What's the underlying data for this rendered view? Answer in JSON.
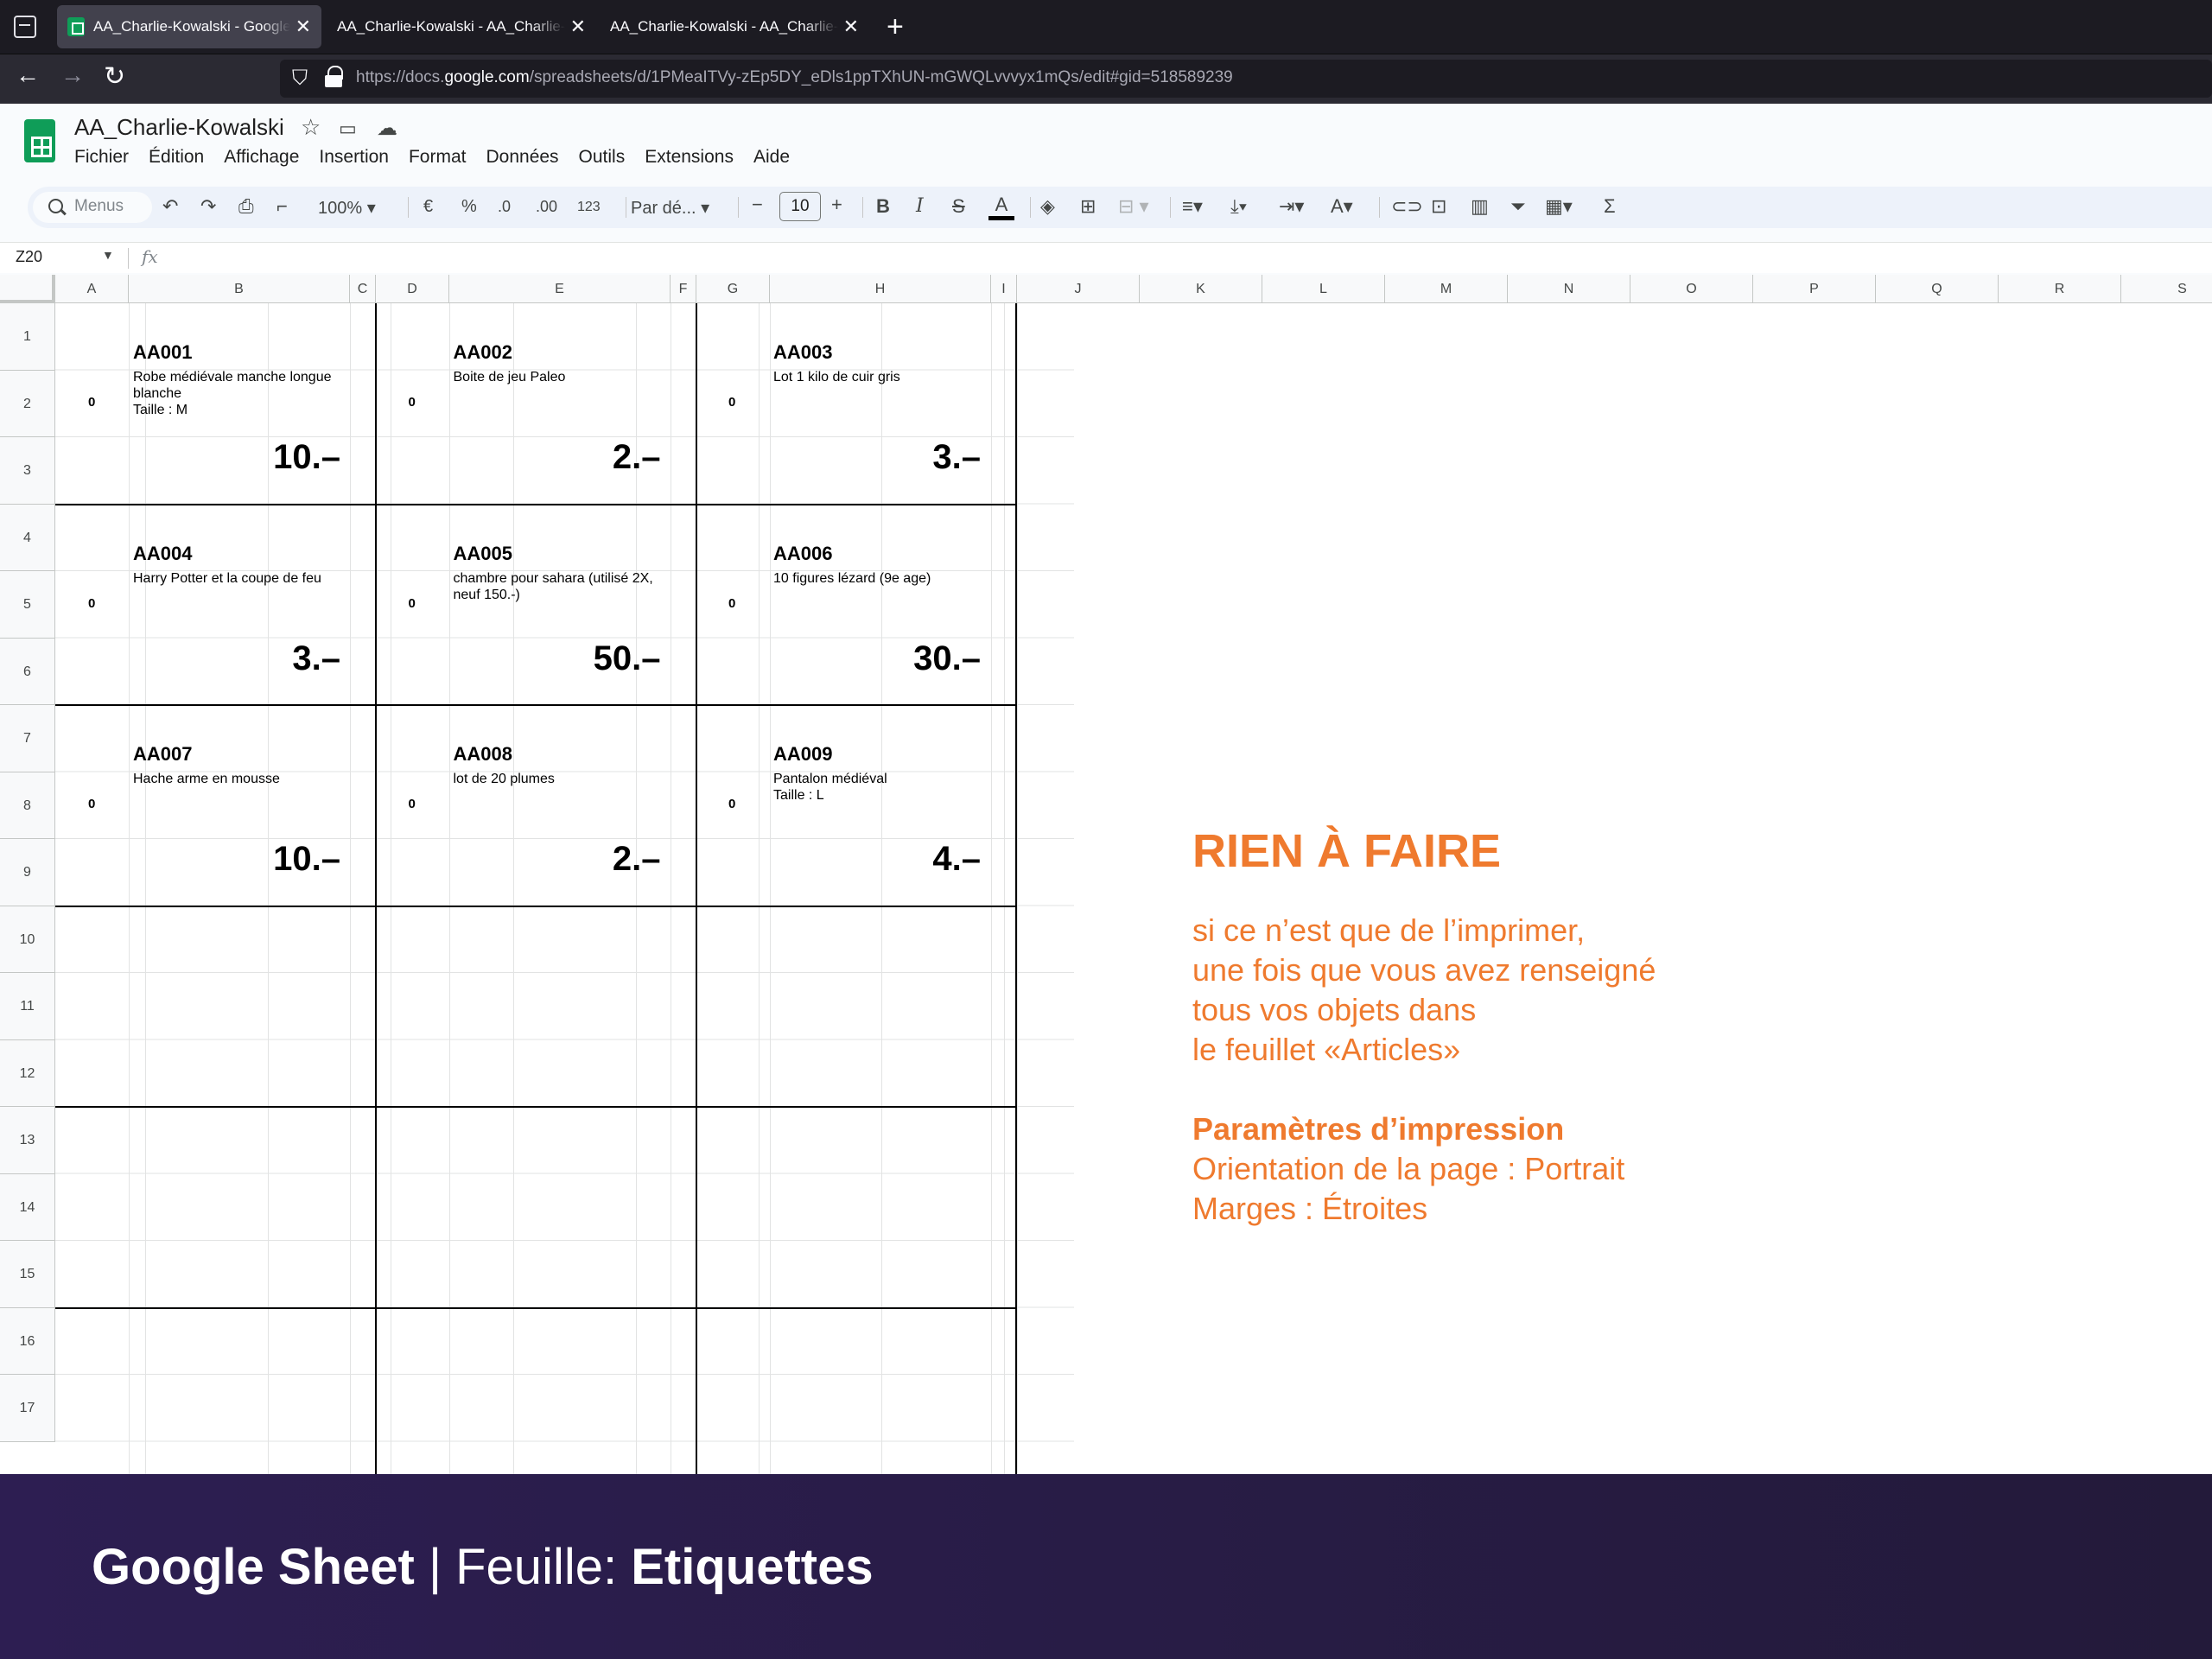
{
  "browser": {
    "tabs": [
      {
        "title": "AA_Charlie-Kowalski - Google Sheets",
        "active": true
      },
      {
        "title": "AA_Charlie-Kowalski - AA_Charlie-Kowalski",
        "active": false
      },
      {
        "title": "AA_Charlie-Kowalski - AA_Charlie-Kowalski",
        "active": false
      }
    ],
    "close_glyph": "✕",
    "new_tab_glyph": "+",
    "url_prefix": "https://docs.",
    "url_domain": "google.com",
    "url_suffix": "/spreadsheets/d/1PMeaITVy-zEp5DY_eDls1ppTXhUN-mGWQLvvvyx1mQs/edit#gid=518589239"
  },
  "sheets": {
    "doc_title": "AA_Charlie-Kowalski",
    "menu": [
      "Fichier",
      "Édition",
      "Affichage",
      "Insertion",
      "Format",
      "Données",
      "Outils",
      "Extensions",
      "Aide"
    ],
    "toolbar": {
      "menus_placeholder": "Menus",
      "zoom": "100%",
      "currency": "€",
      "percent": "%",
      "dec_decrease": ".0",
      "dec_increase": ".00",
      "number_format": "123",
      "font": "Par dé...",
      "font_size": "10",
      "bold": "B",
      "italic": "I",
      "strike": "S",
      "text_color": "A"
    },
    "name_box": "Z20",
    "fx_label": "fx",
    "columns": [
      "A",
      "B",
      "C",
      "D",
      "E",
      "F",
      "G",
      "H",
      "I",
      "J",
      "K",
      "L",
      "M",
      "N",
      "O",
      "P",
      "Q",
      "R",
      "S"
    ],
    "rows": [
      "1",
      "2",
      "3",
      "4",
      "5",
      "6",
      "7",
      "8",
      "9",
      "10",
      "11",
      "12",
      "13",
      "14",
      "15",
      "16",
      "17"
    ],
    "cards": [
      {
        "code": "AA001",
        "desc": "Robe médiévale manche longue blanche",
        "size": "Taille : M",
        "zero": "0",
        "price": "10.–"
      },
      {
        "code": "AA002",
        "desc": "Boite de jeu Paleo",
        "size": "",
        "zero": "0",
        "price": "2.–"
      },
      {
        "code": "AA003",
        "desc": "Lot 1 kilo de cuir gris",
        "size": "",
        "zero": "0",
        "price": "3.–"
      },
      {
        "code": "AA004",
        "desc": "Harry Potter et la coupe de feu",
        "size": "",
        "zero": "0",
        "price": "3.–"
      },
      {
        "code": "AA005",
        "desc": "chambre pour sahara (utilisé 2X, neuf 150.-)",
        "size": "",
        "zero": "0",
        "price": "50.–"
      },
      {
        "code": "AA006",
        "desc": "10 figures lézard (9e age)",
        "size": "",
        "zero": "0",
        "price": "30.–"
      },
      {
        "code": "AA007",
        "desc": "Hache arme en mousse",
        "size": "",
        "zero": "0",
        "price": "10.–"
      },
      {
        "code": "AA008",
        "desc": "lot de 20 plumes",
        "size": "",
        "zero": "0",
        "price": "2.–"
      },
      {
        "code": "AA009",
        "desc": "Pantalon médiéval",
        "size": "Taille : L",
        "zero": "0",
        "price": "4.–"
      }
    ]
  },
  "note": {
    "title": "RIEN À FAIRE",
    "lines": [
      "si ce n’est que de l’imprimer,",
      "une fois que vous avez renseigné",
      "tous vos objets dans",
      "le feuillet «Articles»"
    ],
    "print_title": "Paramètres d’impression",
    "print_lines": [
      "Orientation de la page : Portrait",
      "Marges : Étroites"
    ],
    "color": "#ef7a2e"
  },
  "footer": {
    "app": "Google Sheet",
    "sep": " | ",
    "sheet_label": "Feuille: ",
    "sheet_name": "Etiquettes"
  }
}
